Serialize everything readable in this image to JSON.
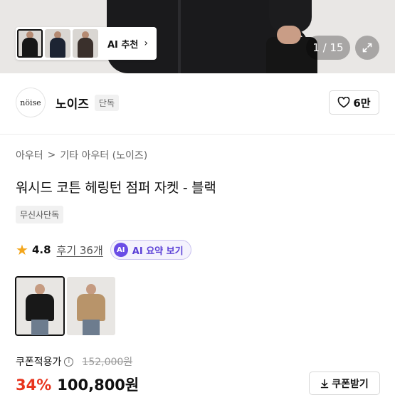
{
  "hero": {
    "ai_recommend_label": "AI 추천",
    "counter": "1 / 15",
    "thumbnails": [
      {
        "name": "black"
      },
      {
        "name": "navy"
      },
      {
        "name": "brown"
      }
    ]
  },
  "brand": {
    "logo_text": "nöise",
    "name": "노이즈",
    "tag": "단독",
    "likes": "6만"
  },
  "breadcrumb": {
    "level1": "아우터",
    "separator": ">",
    "level2": "기타 아우터 (노이즈)"
  },
  "product": {
    "title": "워시드 코튼 헤링턴 점퍼 자켓 - 블랙",
    "exclusive_tag": "무신사단독",
    "rating": "4.8",
    "reviews": "후기 36개",
    "ai_summary": "AI 요약 보기",
    "ai_badge": "AI"
  },
  "price": {
    "coupon_label": "쿠폰적용가",
    "info_icon": "i",
    "original": "152,000원",
    "discount": "34%",
    "final": "100,800원",
    "coupon_button": "쿠폰받기"
  },
  "colors": {
    "accent_red": "#e8341d",
    "star": "#f3a61c",
    "ai_purple": "#6a4ce6"
  }
}
